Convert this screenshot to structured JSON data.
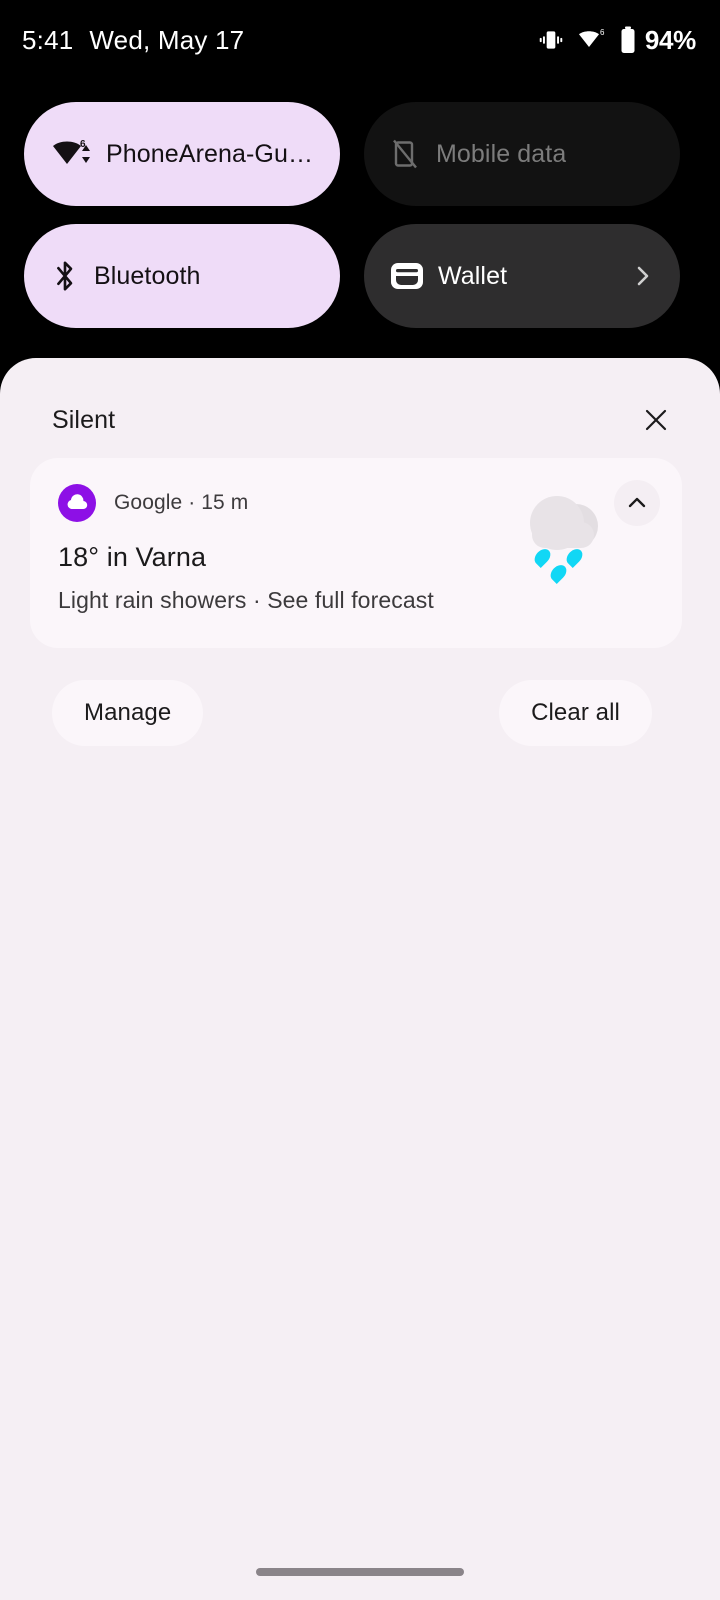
{
  "status_bar": {
    "time": "5:41",
    "date": "Wed, May 17",
    "battery_percent": "94%",
    "icons": [
      "vibrate-icon",
      "wifi-6-icon",
      "battery-icon"
    ]
  },
  "quick_settings": {
    "tiles": [
      {
        "label": "PhoneArena-Guest",
        "icon": "wifi-icon",
        "state": "on",
        "wifi_standard": "6"
      },
      {
        "label": "Mobile data",
        "icon": "mobile-data-off-icon",
        "state": "off"
      },
      {
        "label": "Bluetooth",
        "icon": "bluetooth-icon",
        "state": "on"
      },
      {
        "label": "Wallet",
        "icon": "wallet-icon",
        "state": "off",
        "chevron": "chevron-right-icon"
      }
    ]
  },
  "shade": {
    "section_title": "Silent",
    "close_icon": "close-icon",
    "notification": {
      "app_icon": "google-weather-cloud-icon",
      "source": "Google",
      "separator": "·",
      "time": "15 m",
      "header_line": "Google · 15 m",
      "title": "18° in Varna",
      "body": "Light rain showers · See full forecast",
      "weather_icon": "rain-cloud-icon",
      "expand_icon": "chevron-up-icon"
    },
    "actions": {
      "manage": "Manage",
      "clear_all": "Clear all"
    }
  },
  "navigation": {
    "handle": "home-gesture-handle"
  },
  "colors": {
    "background": "#000000",
    "tile_active": "#efdcf8",
    "tile_inactive": "#121212",
    "tile_wallet": "#2e2d2e",
    "shade_background": "#f5eff4",
    "card_background": "#fbf6fa",
    "app_icon_purple": "#8d10e6",
    "rain_drop": "#11d7f5"
  }
}
